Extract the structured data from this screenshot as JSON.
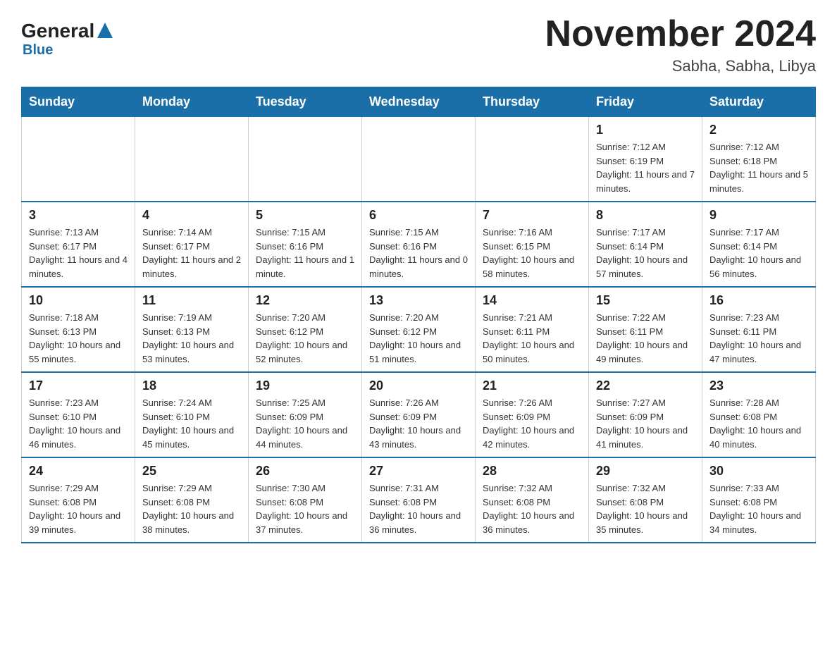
{
  "logo": {
    "general": "General",
    "flag_color": "#1a6fa8",
    "blue": "Blue"
  },
  "header": {
    "title": "November 2024",
    "location": "Sabha, Sabha, Libya"
  },
  "weekdays": [
    "Sunday",
    "Monday",
    "Tuesday",
    "Wednesday",
    "Thursday",
    "Friday",
    "Saturday"
  ],
  "weeks": [
    [
      {
        "day": "",
        "info": ""
      },
      {
        "day": "",
        "info": ""
      },
      {
        "day": "",
        "info": ""
      },
      {
        "day": "",
        "info": ""
      },
      {
        "day": "",
        "info": ""
      },
      {
        "day": "1",
        "info": "Sunrise: 7:12 AM\nSunset: 6:19 PM\nDaylight: 11 hours and 7 minutes."
      },
      {
        "day": "2",
        "info": "Sunrise: 7:12 AM\nSunset: 6:18 PM\nDaylight: 11 hours and 5 minutes."
      }
    ],
    [
      {
        "day": "3",
        "info": "Sunrise: 7:13 AM\nSunset: 6:17 PM\nDaylight: 11 hours and 4 minutes."
      },
      {
        "day": "4",
        "info": "Sunrise: 7:14 AM\nSunset: 6:17 PM\nDaylight: 11 hours and 2 minutes."
      },
      {
        "day": "5",
        "info": "Sunrise: 7:15 AM\nSunset: 6:16 PM\nDaylight: 11 hours and 1 minute."
      },
      {
        "day": "6",
        "info": "Sunrise: 7:15 AM\nSunset: 6:16 PM\nDaylight: 11 hours and 0 minutes."
      },
      {
        "day": "7",
        "info": "Sunrise: 7:16 AM\nSunset: 6:15 PM\nDaylight: 10 hours and 58 minutes."
      },
      {
        "day": "8",
        "info": "Sunrise: 7:17 AM\nSunset: 6:14 PM\nDaylight: 10 hours and 57 minutes."
      },
      {
        "day": "9",
        "info": "Sunrise: 7:17 AM\nSunset: 6:14 PM\nDaylight: 10 hours and 56 minutes."
      }
    ],
    [
      {
        "day": "10",
        "info": "Sunrise: 7:18 AM\nSunset: 6:13 PM\nDaylight: 10 hours and 55 minutes."
      },
      {
        "day": "11",
        "info": "Sunrise: 7:19 AM\nSunset: 6:13 PM\nDaylight: 10 hours and 53 minutes."
      },
      {
        "day": "12",
        "info": "Sunrise: 7:20 AM\nSunset: 6:12 PM\nDaylight: 10 hours and 52 minutes."
      },
      {
        "day": "13",
        "info": "Sunrise: 7:20 AM\nSunset: 6:12 PM\nDaylight: 10 hours and 51 minutes."
      },
      {
        "day": "14",
        "info": "Sunrise: 7:21 AM\nSunset: 6:11 PM\nDaylight: 10 hours and 50 minutes."
      },
      {
        "day": "15",
        "info": "Sunrise: 7:22 AM\nSunset: 6:11 PM\nDaylight: 10 hours and 49 minutes."
      },
      {
        "day": "16",
        "info": "Sunrise: 7:23 AM\nSunset: 6:11 PM\nDaylight: 10 hours and 47 minutes."
      }
    ],
    [
      {
        "day": "17",
        "info": "Sunrise: 7:23 AM\nSunset: 6:10 PM\nDaylight: 10 hours and 46 minutes."
      },
      {
        "day": "18",
        "info": "Sunrise: 7:24 AM\nSunset: 6:10 PM\nDaylight: 10 hours and 45 minutes."
      },
      {
        "day": "19",
        "info": "Sunrise: 7:25 AM\nSunset: 6:09 PM\nDaylight: 10 hours and 44 minutes."
      },
      {
        "day": "20",
        "info": "Sunrise: 7:26 AM\nSunset: 6:09 PM\nDaylight: 10 hours and 43 minutes."
      },
      {
        "day": "21",
        "info": "Sunrise: 7:26 AM\nSunset: 6:09 PM\nDaylight: 10 hours and 42 minutes."
      },
      {
        "day": "22",
        "info": "Sunrise: 7:27 AM\nSunset: 6:09 PM\nDaylight: 10 hours and 41 minutes."
      },
      {
        "day": "23",
        "info": "Sunrise: 7:28 AM\nSunset: 6:08 PM\nDaylight: 10 hours and 40 minutes."
      }
    ],
    [
      {
        "day": "24",
        "info": "Sunrise: 7:29 AM\nSunset: 6:08 PM\nDaylight: 10 hours and 39 minutes."
      },
      {
        "day": "25",
        "info": "Sunrise: 7:29 AM\nSunset: 6:08 PM\nDaylight: 10 hours and 38 minutes."
      },
      {
        "day": "26",
        "info": "Sunrise: 7:30 AM\nSunset: 6:08 PM\nDaylight: 10 hours and 37 minutes."
      },
      {
        "day": "27",
        "info": "Sunrise: 7:31 AM\nSunset: 6:08 PM\nDaylight: 10 hours and 36 minutes."
      },
      {
        "day": "28",
        "info": "Sunrise: 7:32 AM\nSunset: 6:08 PM\nDaylight: 10 hours and 36 minutes."
      },
      {
        "day": "29",
        "info": "Sunrise: 7:32 AM\nSunset: 6:08 PM\nDaylight: 10 hours and 35 minutes."
      },
      {
        "day": "30",
        "info": "Sunrise: 7:33 AM\nSunset: 6:08 PM\nDaylight: 10 hours and 34 minutes."
      }
    ]
  ]
}
